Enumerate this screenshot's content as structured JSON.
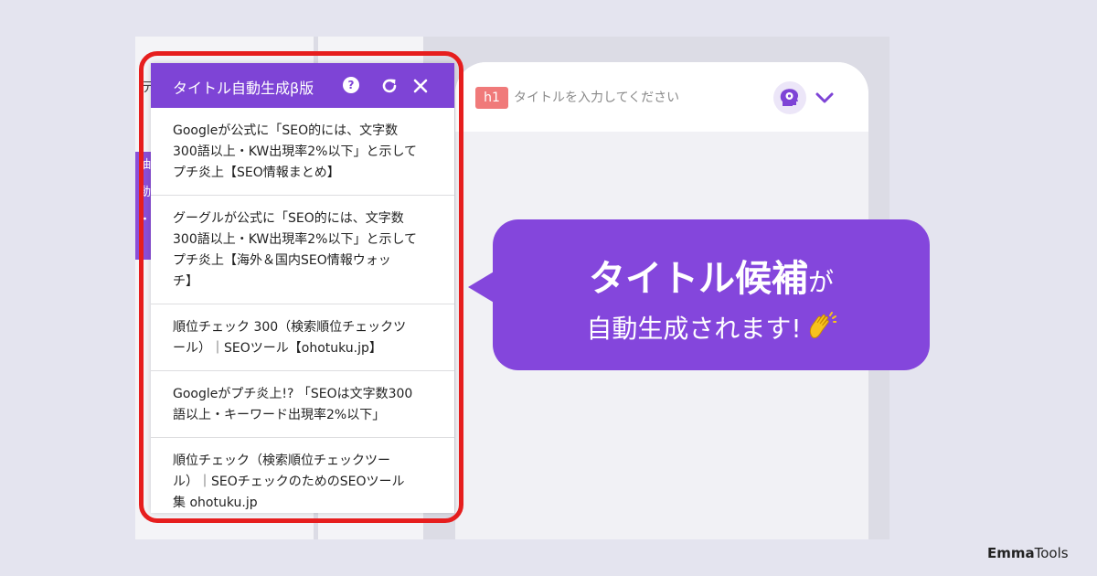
{
  "background_peek": {
    "left_text": "テ",
    "strip_chars": [
      "抽",
      "動",
      "・"
    ]
  },
  "editor": {
    "heading_badge": "h1",
    "title_placeholder": "タイトルを入力してください",
    "ai_icon": "brain-gear-icon",
    "dropdown_icon": "chevron-down-icon"
  },
  "panel": {
    "title": "タイトル自動生成β版",
    "help_symbol": "?",
    "refresh_icon": "refresh-icon",
    "close_icon": "close-icon",
    "suggestions": [
      {
        "line1": "Googleが公式に「SEO的には、文字数",
        "line2": "300語以上・KW出現率2%以下」と示して",
        "line3": "プチ炎上【SEO情報まとめ】"
      },
      {
        "line1": "グーグルが公式に「SEO的には、文字数",
        "line2": "300語以上・KW出現率2%以下」と示して",
        "line3": "プチ炎上【海外＆国内SEO情報ウォッ",
        "line4": "チ】"
      },
      {
        "line1": "順位チェック 300（検索順位チェックツ",
        "line2": "ール）｜SEOツール【ohotuku.jp】"
      },
      {
        "line1": "Googleがプチ炎上!? 「SEOは文字数300",
        "line2": "語以上・キーワード出現率2%以下」"
      },
      {
        "line1": "順位チェック（検索順位チェックツー",
        "line2": "ル）｜SEOチェックのためのSEOツール",
        "line3": "集 ohotuku.jp"
      }
    ]
  },
  "callout": {
    "bold_text": "タイトル候補",
    "particle": "が",
    "line2": "自動生成されます!",
    "emoji_icon": "clapping-hands-icon"
  },
  "brand": {
    "part1": "Emma",
    "part2": "Tools"
  },
  "colors": {
    "accent_purple": "#7e44d6",
    "highlight_red": "#e61e1e",
    "badge_red": "#f07a7a",
    "page_bg": "#e4e4ef"
  }
}
